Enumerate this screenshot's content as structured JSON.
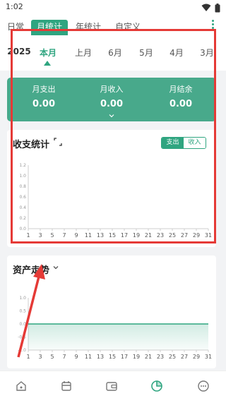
{
  "status_bar": {
    "time": "1:02"
  },
  "top_tabs": [
    {
      "label": "日常",
      "active": false
    },
    {
      "label": "月统计",
      "active": true
    },
    {
      "label": "年统计",
      "active": false
    },
    {
      "label": "自定义",
      "active": false
    }
  ],
  "month_selector": {
    "year": "2025",
    "months": [
      "本月",
      "上月",
      "6月",
      "5月",
      "4月",
      "3月"
    ],
    "active_index": 0
  },
  "summary": {
    "expense_label": "月支出",
    "expense_value": "0.00",
    "income_label": "月收入",
    "income_value": "0.00",
    "balance_label": "月结余",
    "balance_value": "0.00"
  },
  "income_expense_chart": {
    "title": "收支统计",
    "toggle": {
      "expense_label": "支出",
      "income_label": "收入",
      "selected": "支出"
    }
  },
  "asset_trend_chart": {
    "title": "资产走势"
  },
  "chart_data": [
    {
      "type": "line",
      "title": "收支统计",
      "x": [
        1,
        2,
        3,
        4,
        5,
        6,
        7,
        8,
        9,
        10,
        11,
        12,
        13,
        14,
        15,
        16,
        17,
        18,
        19,
        20,
        21,
        22,
        23,
        24,
        25,
        26,
        27,
        28,
        29,
        30,
        31
      ],
      "x_tick_labels": [
        "1",
        "3",
        "5",
        "7",
        "9",
        "11",
        "13",
        "15",
        "17",
        "19",
        "21",
        "23",
        "25",
        "27",
        "29",
        "31"
      ],
      "y_tick_labels": [
        "0.0",
        "0.2",
        "0.4",
        "0.6",
        "0.8",
        "1.0",
        "1.2"
      ],
      "ylim": [
        0,
        1.2
      ],
      "grid": false,
      "series": [
        {
          "values": [
            0,
            0,
            0,
            0,
            0,
            0,
            0,
            0,
            0,
            0,
            0,
            0,
            0,
            0,
            0,
            0,
            0,
            0,
            0,
            0,
            0,
            0,
            0,
            0,
            0,
            0,
            0,
            0,
            0,
            0,
            0
          ]
        }
      ]
    },
    {
      "type": "area",
      "title": "资产走势",
      "x": [
        1,
        2,
        3,
        4,
        5,
        6,
        7,
        8,
        9,
        10,
        11,
        12,
        13,
        14,
        15,
        16,
        17,
        18,
        19,
        20,
        21,
        22,
        23,
        24,
        25,
        26,
        27,
        28,
        29,
        30,
        31
      ],
      "x_tick_labels": [
        "1",
        "3",
        "5",
        "7",
        "9",
        "11",
        "13",
        "15",
        "17",
        "19",
        "21",
        "23",
        "25",
        "27",
        "29",
        "31"
      ],
      "y_tick_labels": [
        "1.0",
        "0.5",
        "0.0",
        "-0.5",
        "-1.0"
      ],
      "ylim": [
        -1.0,
        1.0
      ],
      "grid": false,
      "series": [
        {
          "values": [
            0,
            0,
            0,
            0,
            0,
            0,
            0,
            0,
            0,
            0,
            0,
            0,
            0,
            0,
            0,
            0,
            0,
            0,
            0,
            0,
            0,
            0,
            0,
            0,
            0,
            0,
            0,
            0,
            0,
            0,
            0
          ]
        }
      ]
    }
  ],
  "bottom_nav": [
    {
      "icon": "home-icon",
      "active": false
    },
    {
      "icon": "calendar-icon",
      "active": false
    },
    {
      "icon": "wallet-icon",
      "active": false
    },
    {
      "icon": "pie-chart-icon",
      "active": true
    },
    {
      "icon": "more-icon",
      "active": false
    }
  ],
  "colors": {
    "accent": "#2fa580",
    "summary_bg": "#48a98b",
    "annotation": "#e53a36"
  }
}
